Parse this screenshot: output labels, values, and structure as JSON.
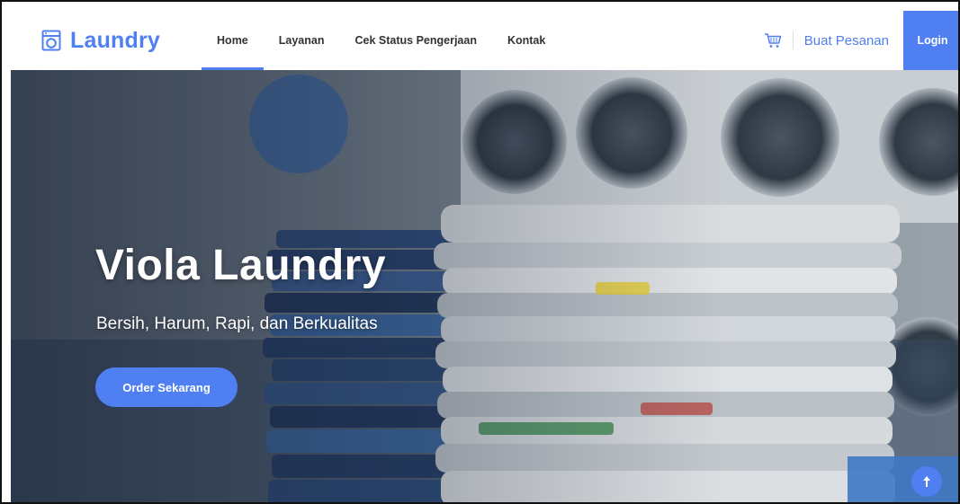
{
  "brand": {
    "name": "Laundry",
    "icon": "washing-machine-icon"
  },
  "nav": {
    "items": [
      {
        "label": "Home",
        "active": true
      },
      {
        "label": "Layanan",
        "active": false
      },
      {
        "label": "Cek Status Pengerjaan",
        "active": false
      },
      {
        "label": "Kontak",
        "active": false
      }
    ],
    "cart_icon": "cart-icon",
    "order_label": "Buat Pesanan",
    "login_label": "Login"
  },
  "hero": {
    "title": "Viola Laundry",
    "subtitle": "Bersih, Harum, Rapi, dan Berkualitas",
    "cta_label": "Order Sekarang",
    "scroll_top_icon": "arrow-up-icon"
  },
  "colors": {
    "accent": "#4f7ff1",
    "text": "#333333",
    "white": "#ffffff"
  }
}
